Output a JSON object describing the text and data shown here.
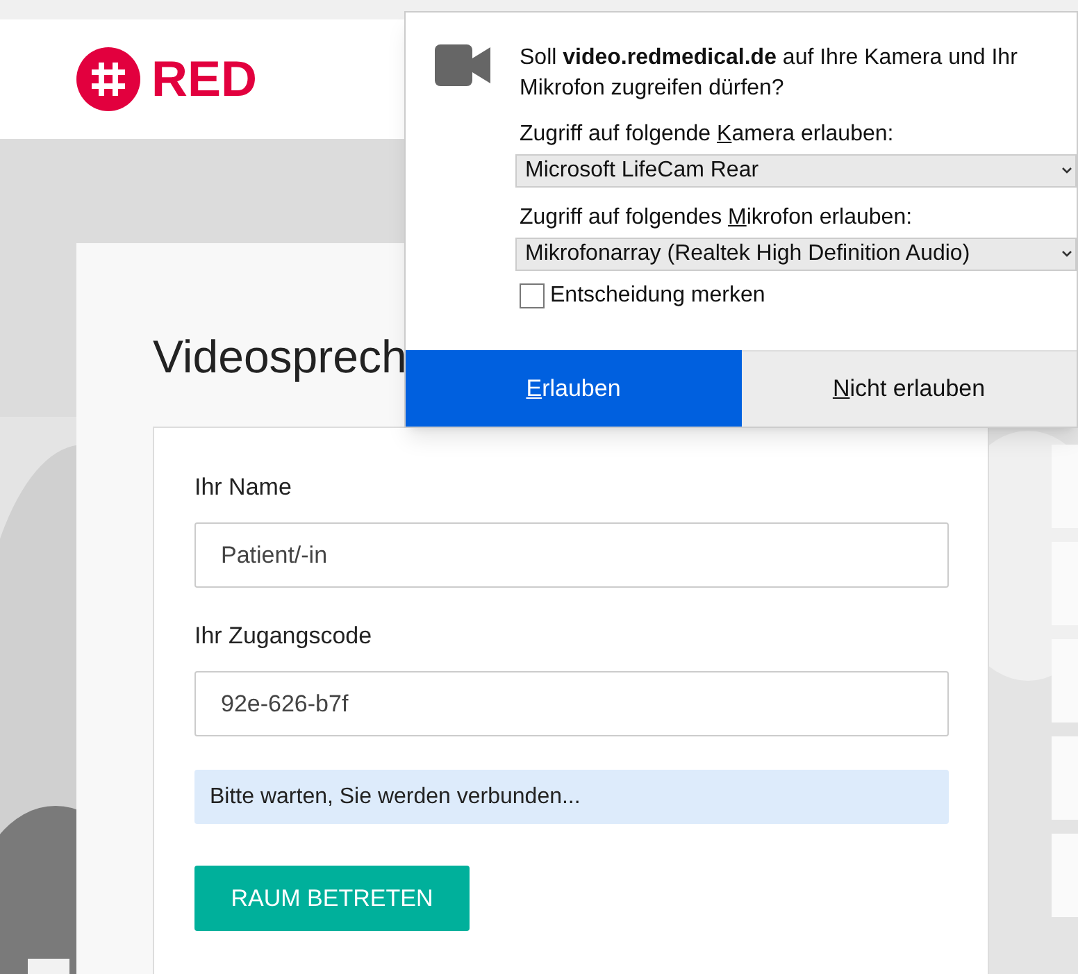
{
  "header": {
    "logo_text": "RED"
  },
  "card": {
    "title": "Videosprech",
    "fields": [
      {
        "label": "Ihr Name",
        "value": "Patient/-in"
      },
      {
        "label": "Ihr Zugangscode",
        "value": "92e-626-b7f"
      }
    ],
    "status_message": "Bitte warten, Sie werden verbunden...",
    "submit_button": "RAUM BETRETEN"
  },
  "permission_popup": {
    "question": "Soll **video.redmedical.de** auf Ihre Kamera und Ihr Mikrofon zugreifen dürfen?",
    "devices": [
      {
        "label_before": "Zugriff auf folgende ",
        "label_key": "K",
        "label_after": "amera erlauben:",
        "value": "Microsoft LifeCam Rear"
      },
      {
        "label_before": "Zugriff auf folgendes ",
        "label_key": "M",
        "label_after": "ikrofon erlauben:",
        "value": "Mikrofonarray (Realtek High Definition Audio)"
      }
    ],
    "remember": {
      "label": "Entscheidung merken",
      "checked": false
    },
    "buttons": [
      {
        "key": "E",
        "rest": "rlauben",
        "kind": "primary"
      },
      {
        "key": "N",
        "rest": "icht erlauben",
        "kind": "secondary"
      }
    ]
  }
}
